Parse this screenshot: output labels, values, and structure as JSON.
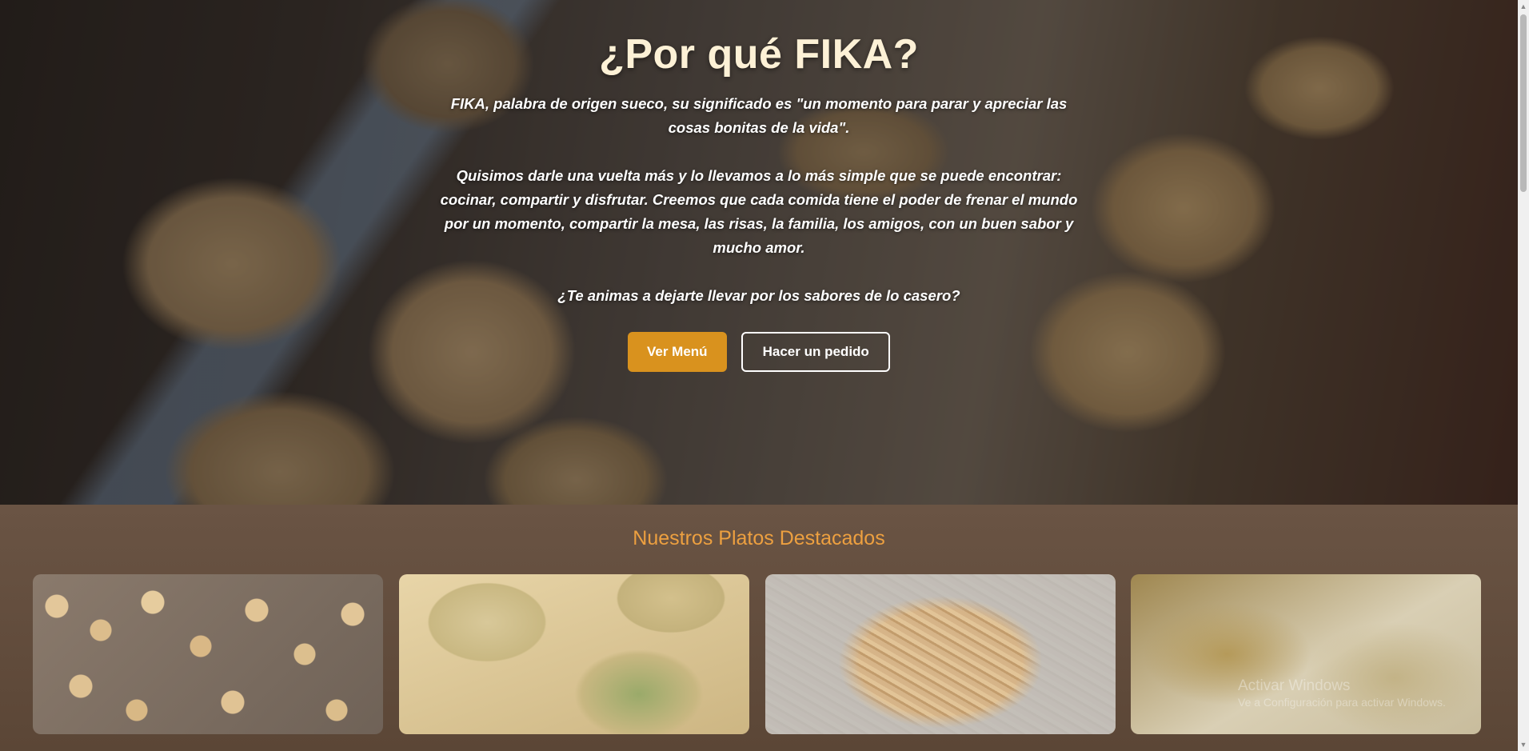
{
  "hero": {
    "title": "¿Por qué FIKA?",
    "paragraphs": [
      "FIKA, palabra de origen sueco, su significado es \"un momento para parar y apreciar las cosas bonitas de la vida\".",
      "Quisimos darle una vuelta más y lo llevamos a lo más simple que se puede encontrar: cocinar, compartir y disfrutar. Creemos que cada comida tiene el poder de frenar el mundo por un momento, compartir la mesa, las risas, la familia, los amigos, con un buen sabor y mucho amor.",
      "¿Te animas a dejarte llevar por los sabores de lo casero?"
    ],
    "buttons": {
      "menu": "Ver Menú",
      "order": "Hacer un pedido"
    }
  },
  "featured": {
    "title": "Nuestros Platos Destacados",
    "cards": [
      {
        "image": "gnocchi-photo"
      },
      {
        "image": "ravioli-photo"
      },
      {
        "image": "fresh-pasta-photo"
      },
      {
        "image": "floured-dough-photo"
      }
    ]
  },
  "watermark": {
    "line1": "Activar Windows",
    "line2": "Ve a Configuración para activar Windows."
  },
  "colors": {
    "accent": "#d9921e",
    "section_title": "#eda040",
    "section_bg": "#5b4636"
  }
}
